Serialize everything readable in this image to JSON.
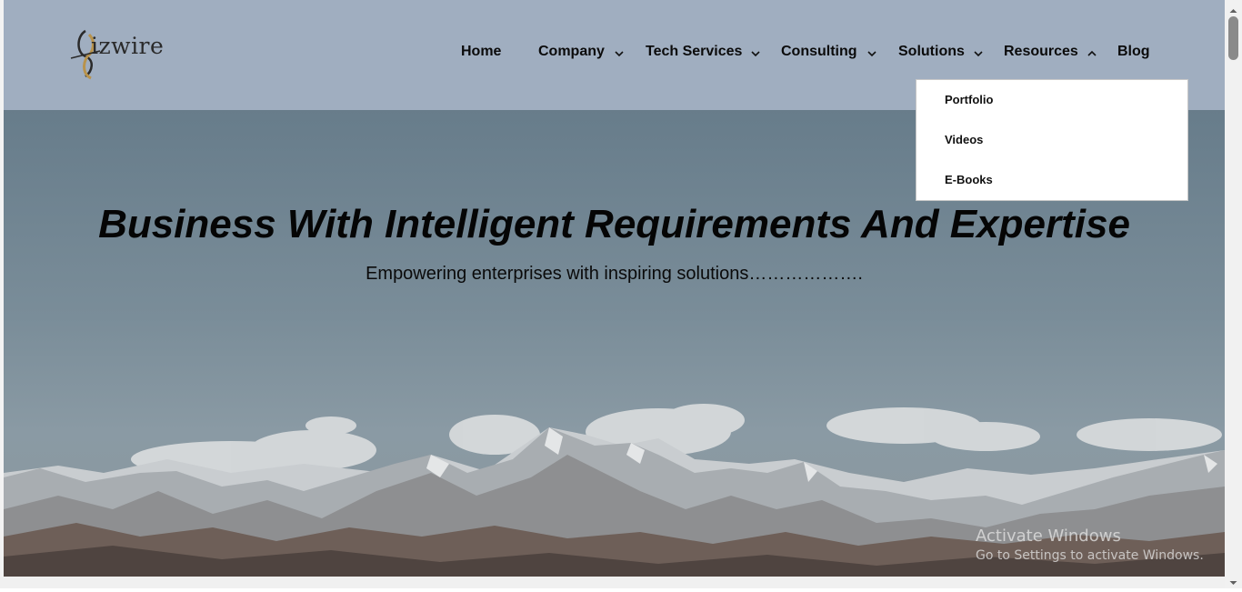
{
  "brand": {
    "logo_text": "izwire"
  },
  "nav": {
    "items": [
      {
        "label": "Home",
        "has_dropdown": false
      },
      {
        "label": "Company",
        "has_dropdown": true
      },
      {
        "label": "Tech Services",
        "has_dropdown": true
      },
      {
        "label": "Consulting",
        "has_dropdown": true
      },
      {
        "label": "Solutions",
        "has_dropdown": true
      },
      {
        "label": "Resources",
        "has_dropdown": true,
        "open": true
      },
      {
        "label": "Blog",
        "has_dropdown": false
      }
    ]
  },
  "resources_dropdown": {
    "items": [
      "Portfolio",
      "Videos",
      "E-Books"
    ]
  },
  "hero": {
    "title": "Business With Intelligent Requirements And Expertise",
    "subtitle": "Empowering enterprises with inspiring solutions………………."
  },
  "watermark": {
    "line1": "Activate Windows",
    "line2": "Go to Settings to activate Windows."
  },
  "colors": {
    "header_bg": "#a0aec0",
    "hero_sky": "#6a7f8d",
    "text": "#050505"
  }
}
